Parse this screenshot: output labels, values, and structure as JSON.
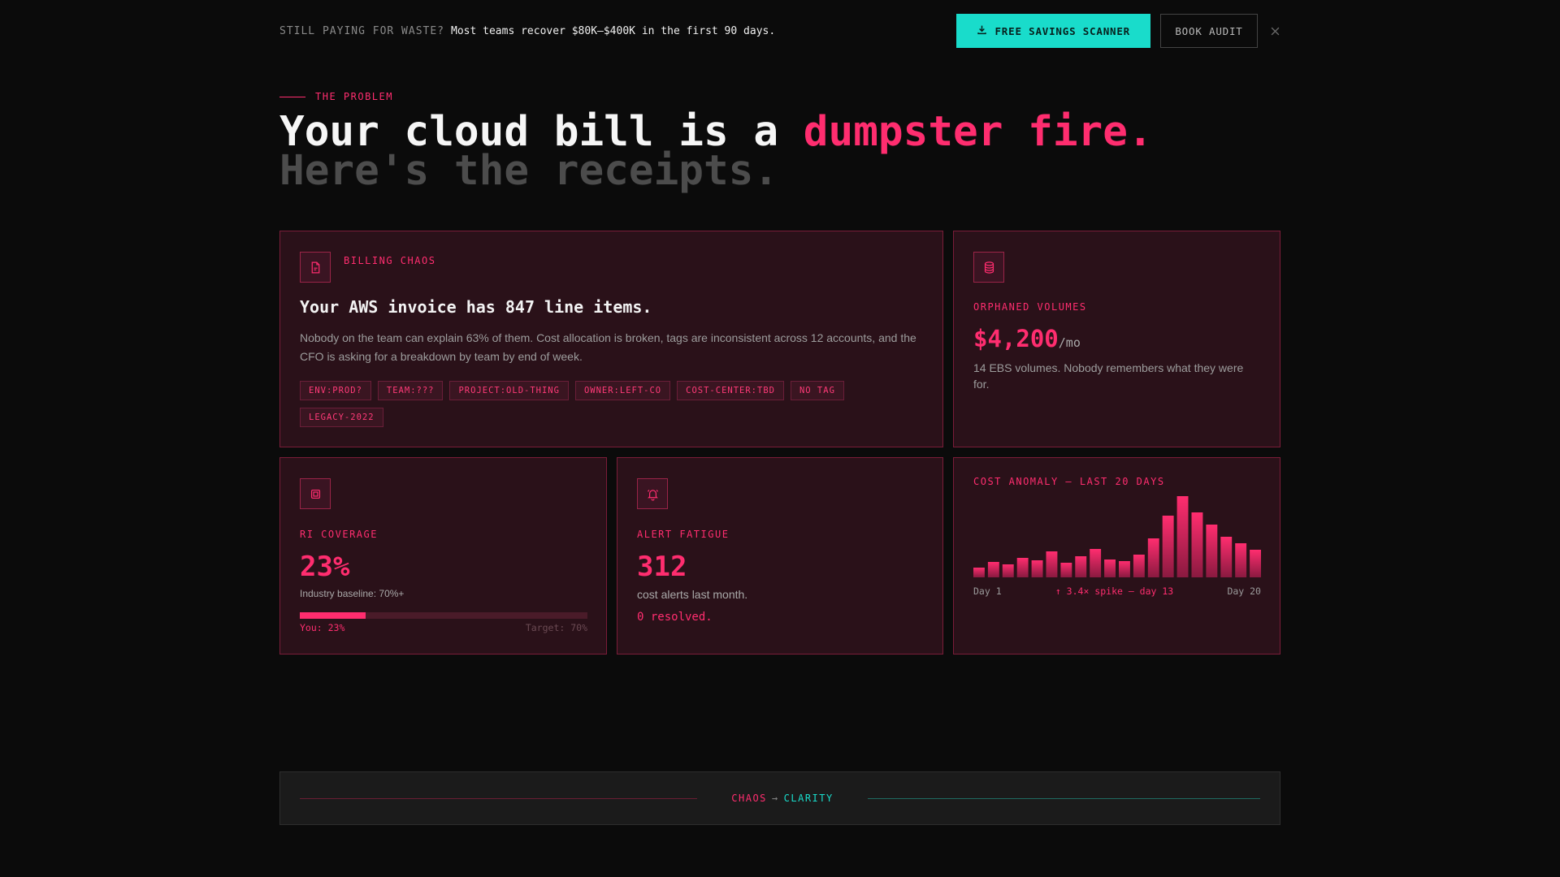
{
  "banner": {
    "lead": "STILL PAYING FOR WASTE?",
    "message": "Most teams recover $80K–$400K in the first 90 days.",
    "primary_button": "FREE SAVINGS SCANNER",
    "secondary_button": "BOOK AUDIT",
    "close_icon": "close-icon"
  },
  "hero": {
    "eyebrow": "THE PROBLEM",
    "headline_start": "Your cloud bill is a ",
    "headline_accent": "dumpster fire.",
    "subheadline": "Here's the receipts."
  },
  "cards": {
    "billing": {
      "icon": "document-icon",
      "label": "BILLING CHAOS",
      "title": "Your AWS invoice has 847 line items.",
      "description": "Nobody on the team can explain 63% of them. Cost allocation is broken, tags are inconsistent across 12 accounts, and the CFO is asking for a breakdown by team by end of week.",
      "tags": [
        "ENV:PROD?",
        "TEAM:???",
        "PROJECT:OLD-THING",
        "OWNER:LEFT-CO",
        "COST-CENTER:TBD",
        "NO TAG",
        "LEGACY-2022"
      ]
    },
    "orphaned": {
      "icon": "database-icon",
      "label": "ORPHANED VOLUMES",
      "value": "$4,200",
      "unit": "/mo",
      "description": "14 EBS volumes. Nobody remembers what they were for."
    },
    "ri": {
      "icon": "chip-icon",
      "label": "RI COVERAGE",
      "value": "23%",
      "baseline": "Industry baseline: 70%+",
      "progress": 0.23,
      "you_label": "You: 23%",
      "target_label": "Target: 70%"
    },
    "alerts": {
      "icon": "bell-icon",
      "label": "ALERT FATIGUE",
      "value": "312",
      "sub": "cost alerts last month.",
      "resolved": "0 resolved."
    },
    "anomaly": {
      "label": "COST ANOMALY — LAST 20 DAYS",
      "start_label": "Day 1",
      "spike_label": "↑ 3.4× spike — day 13",
      "end_label": "Day 20"
    }
  },
  "chart_data": {
    "type": "bar",
    "title": "COST ANOMALY — LAST 20 DAYS",
    "categories": [
      "1",
      "2",
      "3",
      "4",
      "5",
      "6",
      "7",
      "8",
      "9",
      "10",
      "11",
      "12",
      "13",
      "14",
      "15",
      "16",
      "17",
      "18",
      "19",
      "20"
    ],
    "values": [
      12,
      19,
      16,
      24,
      21,
      32,
      18,
      26,
      35,
      22,
      20,
      28,
      48,
      76,
      100,
      80,
      65,
      50,
      42,
      34
    ],
    "xlabel": "",
    "ylabel": "",
    "ylim": [
      0,
      100
    ],
    "grid": false,
    "color": "#ff2d6f"
  },
  "footer": {
    "left": "CHAOS",
    "arrow": "→",
    "right": "CLARITY"
  },
  "colors": {
    "accent": "#ff2d6f",
    "teal": "#19dccb",
    "card_bg": "#2a1119"
  }
}
